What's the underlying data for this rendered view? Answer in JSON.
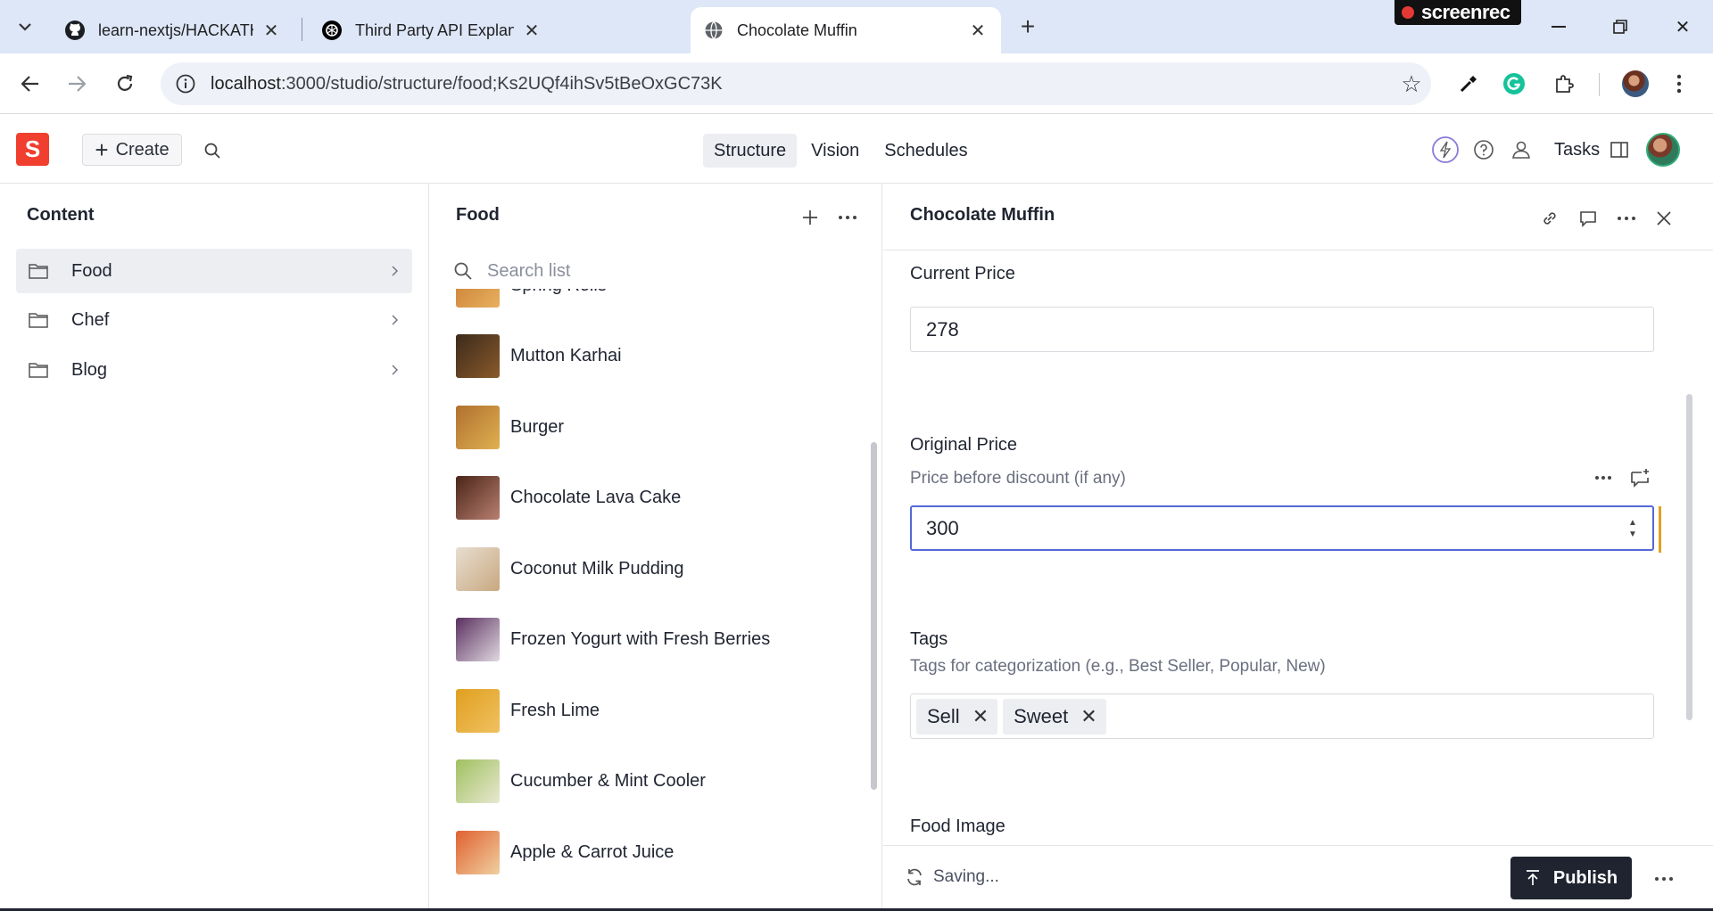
{
  "browser": {
    "tabs": [
      {
        "title": "learn-nextjs/HACKATHONS/Mar",
        "favicon": "github-icon"
      },
      {
        "title": "Third Party API Explanation",
        "favicon": "openai-icon"
      },
      {
        "title": "Chocolate Muffin",
        "favicon": "globe-icon"
      }
    ],
    "recorder_label": "screenrec",
    "url_host": "localhost",
    "url_path": ":3000/studio/structure/food;Ks2UQf4ihSv5tBeOxGC73K"
  },
  "studio": {
    "logo": "S",
    "create_label": "Create",
    "nav": [
      "Structure",
      "Vision",
      "Schedules"
    ],
    "active_nav": "Structure",
    "tasks_label": "Tasks"
  },
  "content_pane": {
    "title": "Content",
    "items": [
      {
        "label": "Food",
        "selected": true
      },
      {
        "label": "Chef",
        "selected": false
      },
      {
        "label": "Blog",
        "selected": false
      }
    ]
  },
  "food_pane": {
    "title": "Food",
    "search_placeholder": "Search list",
    "items": [
      {
        "name": "Spring Rolls",
        "thumb": [
          "#c77a2e",
          "#e8b060"
        ]
      },
      {
        "name": "Mutton Karhai",
        "thumb": [
          "#3b2a1c",
          "#8a5a2a"
        ]
      },
      {
        "name": "Burger",
        "thumb": [
          "#b07030",
          "#e0b050"
        ]
      },
      {
        "name": "Chocolate Lava Cake",
        "thumb": [
          "#4a2418",
          "#b88070"
        ]
      },
      {
        "name": "Coconut Milk Pudding",
        "thumb": [
          "#e8ded0",
          "#c8a880"
        ]
      },
      {
        "name": "Frozen Yogurt with Fresh Berries",
        "thumb": [
          "#5a3060",
          "#e0d8e0"
        ]
      },
      {
        "name": "Fresh Lime",
        "thumb": [
          "#e0a020",
          "#f0c060"
        ]
      },
      {
        "name": "Cucumber & Mint Cooler",
        "thumb": [
          "#a0c060",
          "#e8e8d0"
        ]
      },
      {
        "name": "Apple & Carrot Juice",
        "thumb": [
          "#e06030",
          "#f0d0a0"
        ]
      }
    ]
  },
  "document": {
    "title": "Chocolate Muffin",
    "current_price": {
      "label": "Current Price",
      "value": "278"
    },
    "original_price": {
      "label": "Original Price",
      "description": "Price before discount (if any)",
      "value": "300"
    },
    "tags": {
      "label": "Tags",
      "description": "Tags for categorization (e.g., Best Seller, Popular, New)",
      "values": [
        "Sell",
        "Sweet"
      ]
    },
    "food_image_label": "Food Image",
    "status": "Saving...",
    "publish_label": "Publish"
  },
  "colors": {
    "brand": "#f03e2f",
    "focus": "#5568d6",
    "changed": "#e2a21e",
    "publish_bg": "#1f2430"
  }
}
